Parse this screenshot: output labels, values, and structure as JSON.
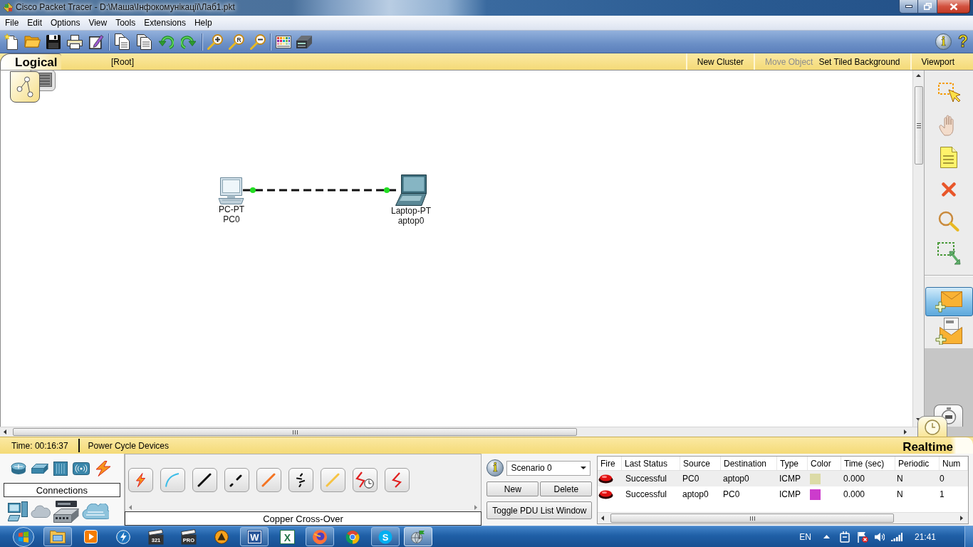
{
  "window": {
    "title": "Cisco Packet Tracer - D:\\Маша\\Інфокомунікації\\Лаб1.pkt"
  },
  "menu": [
    "File",
    "Edit",
    "Options",
    "View",
    "Tools",
    "Extensions",
    "Help"
  ],
  "toolbar": {
    "zoom_reset_mark": "R",
    "info_mark": "i",
    "help_mark": "?"
  },
  "workspace_tabs": [
    {
      "kind": "logical",
      "label": "Logical",
      "selected": true
    },
    {
      "kind": "physical",
      "selected": false
    }
  ],
  "workspace_bar": {
    "path": "[Root]",
    "action_groups": [
      [
        {
          "label": "New Cluster",
          "disabled": false
        }
      ],
      [
        {
          "label": "Move Object",
          "disabled": true
        },
        {
          "label": "Set Tiled Background",
          "disabled": false
        }
      ],
      [
        {
          "label": "Viewport",
          "disabled": false
        }
      ]
    ]
  },
  "canvas": {
    "devices": [
      {
        "kind": "pc",
        "model": "PC-PT",
        "name": "PC0"
      },
      {
        "kind": "laptop",
        "model": "Laptop-PT",
        "name": "aptop0"
      }
    ],
    "link": {
      "up": true
    }
  },
  "tools": [
    {
      "kind": "select",
      "selected": false
    },
    {
      "kind": "move",
      "selected": false
    },
    {
      "kind": "note",
      "selected": false
    },
    {
      "kind": "delete",
      "selected": false
    },
    {
      "kind": "inspect",
      "selected": false
    },
    {
      "kind": "resize",
      "selected": false
    }
  ],
  "pdu_tools": [
    {
      "kind": "simple_pdu",
      "selected": true
    },
    {
      "kind": "complex_pdu",
      "selected": false
    }
  ],
  "mode_tabs": [
    {
      "kind": "realtime",
      "label": "Realtime",
      "selected": true
    },
    {
      "kind": "simulation",
      "selected": false
    }
  ],
  "status_bar": {
    "time": "Time: 00:16:37",
    "action": "Power Cycle Devices"
  },
  "device_panel": {
    "category_label": "Connections",
    "type_label": "Copper Cross-Over"
  },
  "scenario": {
    "info_mark": "i",
    "value": "Scenario 0",
    "buttons": [
      "New",
      "Delete",
      "Toggle PDU List Window"
    ]
  },
  "pdu_table": {
    "columns": [
      "Fire",
      "Last Status",
      "Source",
      "Destination",
      "Type",
      "Color",
      "Time (sec)",
      "Periodic",
      "Num"
    ],
    "rows": [
      {
        "last_status": "Successful",
        "source": "PC0",
        "destination": "aptop0",
        "type": "ICMP",
        "color": "#dcdba6",
        "time": "0.000",
        "periodic": "N",
        "num": "0"
      },
      {
        "last_status": "Successful",
        "source": "aptop0",
        "destination": "PC0",
        "type": "ICMP",
        "color": "#cc3ccc",
        "time": "0.000",
        "periodic": "N",
        "num": "1"
      }
    ]
  },
  "taskbar": {
    "apps": [
      {
        "kind": "explorer",
        "running": true,
        "active": false
      },
      {
        "kind": "media_player",
        "running": false,
        "active": false
      },
      {
        "kind": "lightning",
        "running": false,
        "active": false
      },
      {
        "kind": "clapper",
        "mark": "321",
        "running": false,
        "active": false
      },
      {
        "kind": "clapper",
        "mark": "PRO",
        "running": false,
        "active": false
      },
      {
        "kind": "aimp",
        "running": false,
        "active": false
      },
      {
        "kind": "word",
        "mark": "W",
        "running": true,
        "active": false
      },
      {
        "kind": "excel",
        "mark": "X",
        "running": false,
        "active": false
      },
      {
        "kind": "firefox",
        "running": true,
        "active": false
      },
      {
        "kind": "chrome",
        "running": false,
        "active": false
      },
      {
        "kind": "skype",
        "mark": "S",
        "running": true,
        "active": false
      },
      {
        "kind": "packet_tracer",
        "running": true,
        "active": true
      }
    ],
    "language": "EN",
    "clock": "21:41"
  }
}
